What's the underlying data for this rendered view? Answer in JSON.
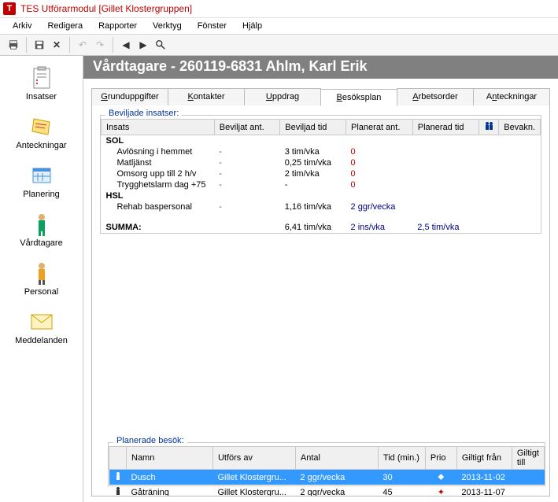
{
  "title": "TES Utförarmodul  [Gillet Klostergruppen]",
  "app_icon_letter": "T",
  "menubar": {
    "arkiv": "Arkiv",
    "redigera": "Redigera",
    "rapporter": "Rapporter",
    "verktyg": "Verktyg",
    "fonster": "Fönster",
    "hjalp": "Hjälp"
  },
  "sidebar": {
    "items": [
      {
        "label": "Insatser"
      },
      {
        "label": "Anteckningar"
      },
      {
        "label": "Planering"
      },
      {
        "label": "Vårdtagare"
      },
      {
        "label": "Personal"
      },
      {
        "label": "Meddelanden"
      }
    ]
  },
  "page_header": "Vårdtagare - 260119-6831 Ahlm, Karl Erik",
  "tabs": {
    "items": [
      {
        "prefix": "",
        "mnemonic": "G",
        "rest": "runduppgifter"
      },
      {
        "prefix": "",
        "mnemonic": "K",
        "rest": "ontakter"
      },
      {
        "prefix": "",
        "mnemonic": "U",
        "rest": "ppdrag"
      },
      {
        "prefix": "",
        "mnemonic": "B",
        "rest": "esöksplan"
      },
      {
        "prefix": "",
        "mnemonic": "A",
        "rest": "rbetsorder"
      },
      {
        "prefix": "A",
        "mnemonic": "n",
        "rest": "teckningar"
      }
    ],
    "active_index": 3
  },
  "beviljade": {
    "legend": "Beviljade insatser:",
    "columns": {
      "insats": "Insats",
      "beviljat_ant": "Beviljat ant.",
      "beviljad_tid": "Beviljad tid",
      "planerat_ant": "Planerat ant.",
      "planerad_tid": "Planerad tid",
      "persons": "👥",
      "bevakn": "Bevakn."
    },
    "groups": [
      {
        "name": "SOL",
        "rows": [
          {
            "insats": "Avlösning i hemmet",
            "bev_ant": "-",
            "bev_tid": "3 tim/vka",
            "plan_ant": "0"
          },
          {
            "insats": "Matljänst",
            "bev_ant": "-",
            "bev_tid": "0,25 tim/vka",
            "plan_ant": "0"
          },
          {
            "insats": "Omsorg upp till 2 h/v",
            "bev_ant": "-",
            "bev_tid": "2 tim/vka",
            "plan_ant": "0"
          },
          {
            "insats": "Trygghetslarm dag +75",
            "bev_ant": "-",
            "bev_tid": "-",
            "plan_ant": "0"
          }
        ]
      },
      {
        "name": "HSL",
        "rows": [
          {
            "insats": "Rehab baspersonal",
            "bev_ant": "-",
            "bev_tid": "1,16 tim/vka",
            "plan_ant_navy": "2 ggr/vecka"
          }
        ]
      }
    ],
    "summa": {
      "label": "SUMMA:",
      "bev_tid": "6,41 tim/vka",
      "plan_ant": "2 ins/vka",
      "plan_tid": "2,5 tim/vka"
    }
  },
  "planerade": {
    "legend": "Planerade besök:",
    "columns": {
      "namn": "Namn",
      "utfors": "Utförs av",
      "antal": "Antal",
      "tid": "Tid (min.)",
      "prio": "Prio",
      "gfran": "Giltigt från",
      "gtill": "Giltigt till"
    },
    "rows": [
      {
        "namn": "Dusch",
        "utfors": "Gillet Klostergru...",
        "antal": "2 ggr/vecka",
        "tid": "30",
        "prio_glyph": "⬥",
        "gfran": "2013-11-02",
        "selected": true
      },
      {
        "namn": "Gåträning",
        "utfors": "Gillet Klostergru...",
        "antal": "2 ggr/vecka",
        "tid": "45",
        "prio_glyph": "✦",
        "gfran": "2013-11-07",
        "selected": false
      }
    ]
  }
}
